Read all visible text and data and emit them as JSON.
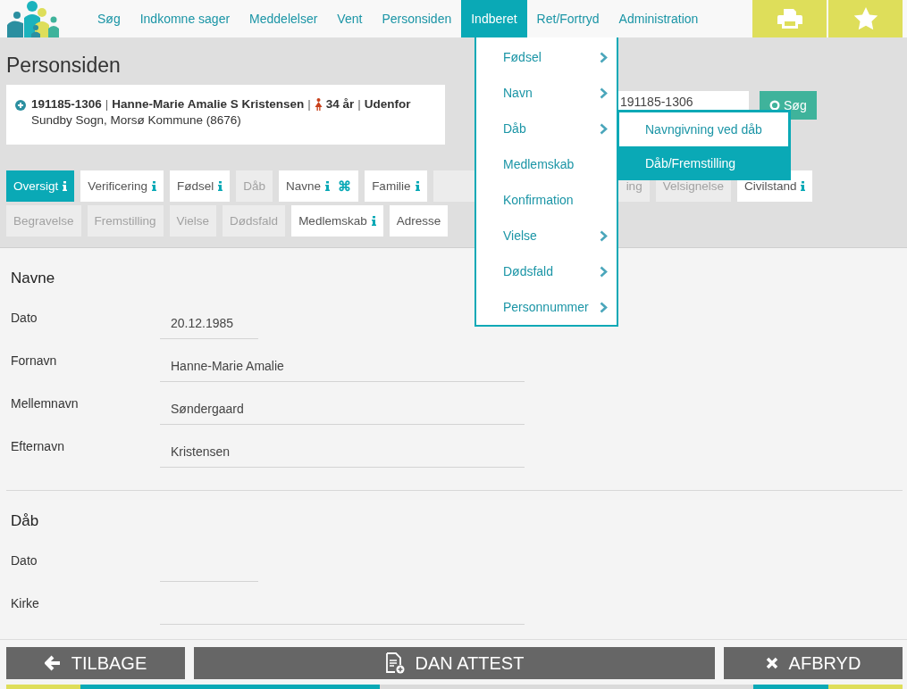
{
  "nav": {
    "items": [
      {
        "label": "Søg",
        "selected": false
      },
      {
        "label": "Indkomne sager",
        "selected": false
      },
      {
        "label": "Meddelelser",
        "selected": false
      },
      {
        "label": "Vent",
        "selected": false
      },
      {
        "label": "Personsiden",
        "selected": false
      },
      {
        "label": "Indberet",
        "selected": true
      },
      {
        "label": "Ret/Fortryd",
        "selected": false
      },
      {
        "label": "Administration",
        "selected": false
      }
    ]
  },
  "page_title": "Personsiden",
  "person": {
    "separator": "|",
    "id": "191185-1306",
    "name": "Hanne-Marie Amalie S Kristensen",
    "age": "34 år",
    "status": "Udenfor",
    "location": "Sundby Sogn, Morsø Kommune (8676)"
  },
  "search": {
    "value": "191185-1306",
    "button": "Søg"
  },
  "tab_rows": [
    [
      {
        "label": "Oversigt",
        "selected": true,
        "disabled": false,
        "info": true
      },
      {
        "label": "Verificering",
        "selected": false,
        "disabled": false,
        "info": true
      },
      {
        "label": "Fødsel",
        "selected": false,
        "disabled": false,
        "info": true
      },
      {
        "label": "Dåb",
        "selected": false,
        "disabled": true,
        "info": false
      },
      {
        "label": "Navne",
        "selected": false,
        "disabled": false,
        "info": true,
        "badge": "⌘"
      },
      {
        "label": "Familie",
        "selected": false,
        "disabled": false,
        "info": true
      },
      {
        "label": "ing",
        "selected": false,
        "disabled": true,
        "info": false,
        "partly_hidden": true
      },
      {
        "label": "Velsignelse",
        "selected": false,
        "disabled": true,
        "info": false
      },
      {
        "label": "Civilstand",
        "selected": false,
        "disabled": false,
        "info": true
      }
    ],
    [
      {
        "label": "Begravelse",
        "selected": false,
        "disabled": true,
        "info": false
      },
      {
        "label": "Fremstilling",
        "selected": false,
        "disabled": true,
        "info": false
      },
      {
        "label": "Vielse",
        "selected": false,
        "disabled": true,
        "info": false
      },
      {
        "label": "Dødsfald",
        "selected": false,
        "disabled": true,
        "info": false
      },
      {
        "label": "Medlemskab",
        "selected": false,
        "disabled": false,
        "info": true
      },
      {
        "label": "Adresse",
        "selected": false,
        "disabled": false,
        "info": false
      }
    ]
  ],
  "menu": {
    "items": [
      {
        "label": "Fødsel",
        "has_submenu": true
      },
      {
        "label": "Navn",
        "has_submenu": true
      },
      {
        "label": "Dåb",
        "has_submenu": true,
        "children": [
          {
            "label": "Navngivning ved dåb",
            "selected": false
          },
          {
            "label": "Dåb/Fremstilling",
            "selected": true
          }
        ]
      },
      {
        "label": "Medlemskab",
        "has_submenu": false
      },
      {
        "label": "Konfirmation",
        "has_submenu": false
      },
      {
        "label": "Vielse",
        "has_submenu": true
      },
      {
        "label": "Dødsfald",
        "has_submenu": true
      },
      {
        "label": "Personnummer",
        "has_submenu": true
      }
    ]
  },
  "sections": [
    {
      "title": "Navne",
      "fields": [
        {
          "label": "Dato",
          "value": "20.12.1985",
          "kind": "date"
        },
        {
          "label": "Fornavn",
          "value": "Hanne-Marie Amalie",
          "kind": "text"
        },
        {
          "label": "Mellemnavn",
          "value": "Søndergaard",
          "kind": "text"
        },
        {
          "label": "Efternavn",
          "value": "Kristensen",
          "kind": "text"
        }
      ]
    },
    {
      "title": "Dåb",
      "fields": [
        {
          "label": "Dato",
          "kind": "date"
        },
        {
          "label": "Kirke",
          "kind": "text"
        }
      ]
    }
  ],
  "footer": {
    "buttons": [
      {
        "label": "TILBAGE",
        "kind": "back"
      },
      {
        "label": "DAN ATTEST",
        "kind": "document"
      },
      {
        "label": "AFBRYD",
        "kind": "cancel"
      }
    ]
  }
}
